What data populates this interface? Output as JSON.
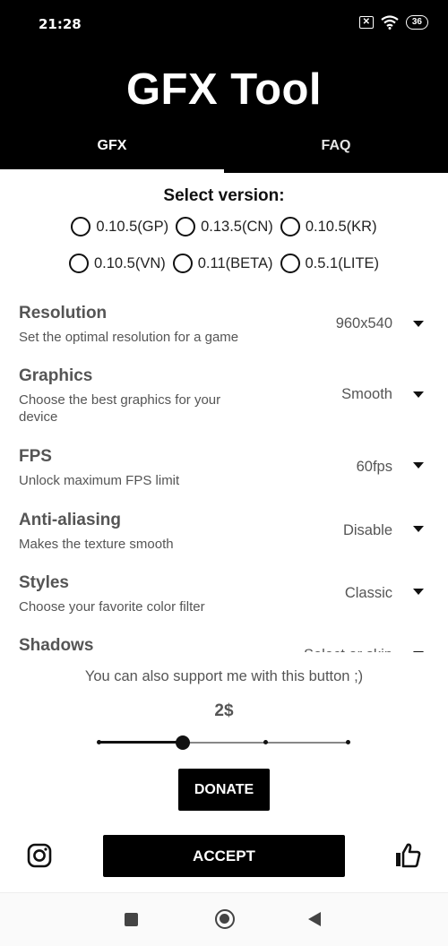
{
  "status_bar": {
    "time": "21:28",
    "sim_icon": "no-sim-icon",
    "wifi_icon": "wifi-icon",
    "battery": "36"
  },
  "header": {
    "title": "GFX Tool"
  },
  "tabs": [
    {
      "label": "GFX",
      "active": true
    },
    {
      "label": "FAQ",
      "active": false
    }
  ],
  "version": {
    "title": "Select version:",
    "options_row1": [
      "0.10.5(GP)",
      "0.13.5(CN)",
      "0.10.5(KR)"
    ],
    "options_row2": [
      "0.10.5(VN)",
      "0.11(BETA)",
      "0.5.1(LITE)"
    ]
  },
  "settings": [
    {
      "title": "Resolution",
      "desc": "Set the optimal resolution for a game",
      "value": "960x540"
    },
    {
      "title": "Graphics",
      "desc": "Choose the best graphics for your device",
      "value": "Smooth"
    },
    {
      "title": "FPS",
      "desc": "Unlock maximum FPS limit",
      "value": "60fps"
    },
    {
      "title": "Anti-aliasing",
      "desc": "Makes the texture smooth",
      "value": "Disable"
    },
    {
      "title": "Styles",
      "desc": "Choose your favorite color filter",
      "value": "Classic"
    },
    {
      "title": "Shadows",
      "desc": "",
      "value": "Select or skip"
    }
  ],
  "donate": {
    "support_text": "You can also support me with this button ;)",
    "amount": "2$",
    "slider_position_fraction": 0.33,
    "button_label": "DONATE"
  },
  "actions": {
    "accept_label": "ACCEPT",
    "left_icon": "instagram-icon",
    "right_icon": "thumbs-up-icon"
  },
  "nav": {
    "recent_icon": "recent-apps-icon",
    "home_icon": "home-icon",
    "back_icon": "back-icon"
  },
  "colors": {
    "header_bg": "#000000",
    "accent": "#000000",
    "muted_text": "#555555"
  }
}
